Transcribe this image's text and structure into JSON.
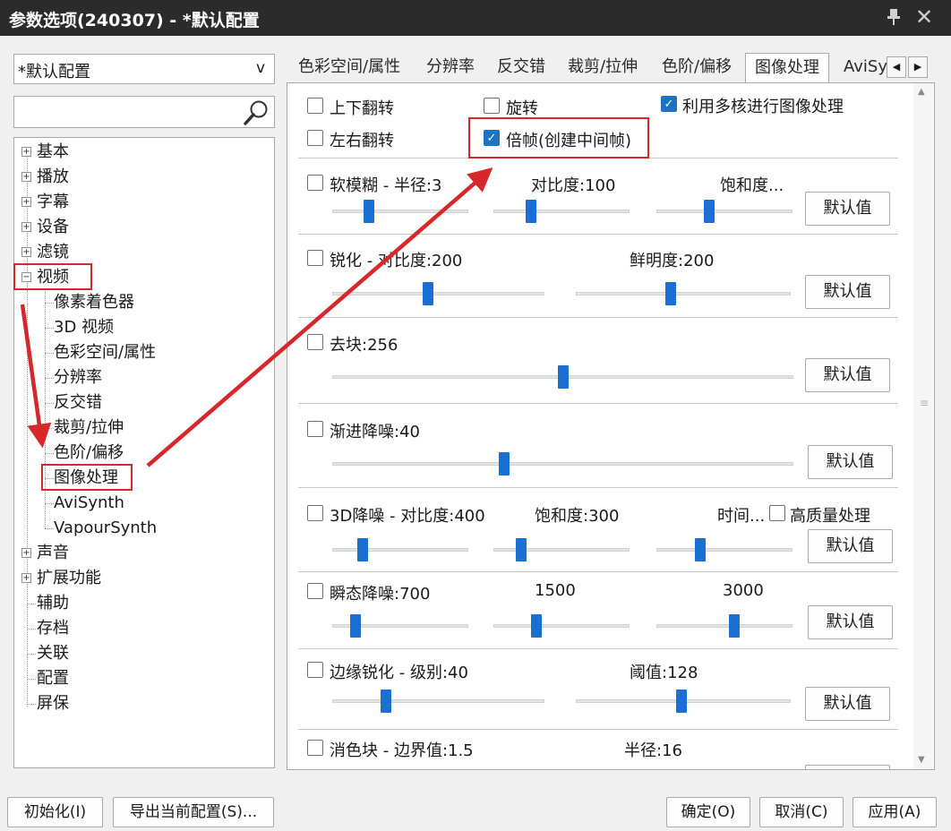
{
  "window": {
    "title": "参数选项(240307) - *默认配置",
    "pin_icon": "pin-icon",
    "close_icon": "close-icon",
    "close_glyph": "✕"
  },
  "profile_select": {
    "value": "*默认配置",
    "arrow": "v"
  },
  "search": {
    "value": "",
    "placeholder": "",
    "icon": "search-icon"
  },
  "tree": {
    "items": [
      {
        "label": "基本",
        "exp": "+"
      },
      {
        "label": "播放",
        "exp": "+"
      },
      {
        "label": "字幕",
        "exp": "+"
      },
      {
        "label": "设备",
        "exp": "+"
      },
      {
        "label": "滤镜",
        "exp": "+"
      },
      {
        "label": "视频",
        "exp": "−"
      },
      {
        "label": "像素着色器"
      },
      {
        "label": "3D 视频"
      },
      {
        "label": "色彩空间/属性"
      },
      {
        "label": "分辨率"
      },
      {
        "label": "反交错"
      },
      {
        "label": "裁剪/拉伸"
      },
      {
        "label": "色阶/偏移"
      },
      {
        "label": "图像处理"
      },
      {
        "label": "AviSynth"
      },
      {
        "label": "VapourSynth"
      },
      {
        "label": "声音",
        "exp": "+"
      },
      {
        "label": "扩展功能",
        "exp": "+"
      },
      {
        "label": "辅助"
      },
      {
        "label": "存档"
      },
      {
        "label": "关联"
      },
      {
        "label": "配置"
      },
      {
        "label": "屏保"
      }
    ]
  },
  "tabs": [
    "色彩空间/属性",
    "分辨率",
    "反交错",
    "裁剪/拉伸",
    "色阶/偏移",
    "图像处理",
    "AviSy"
  ],
  "tab_scroll": {
    "left": "◀",
    "right": "▶"
  },
  "scrollbar": {
    "up": "▲",
    "down": "▼",
    "grip": "≡"
  },
  "options": {
    "flip_v": "上下翻转",
    "rotate": "旋转",
    "multicore": "利用多核进行图像处理",
    "flip_h": "左右翻转",
    "double_frame": "倍帧(创建中间帧)"
  },
  "check_glyph": "✓",
  "sections": {
    "soft_blur": {
      "label": "软模糊 - 半径:3",
      "contrast": "对比度:100",
      "saturation": "饱和度...",
      "button": "默认值",
      "levels": [
        0.25,
        0.26,
        0.38
      ]
    },
    "sharpen": {
      "label": "锐化 - 对比度:200",
      "vividness": "鲜明度:200",
      "button": "默认值",
      "levels": [
        0.45,
        0.44
      ]
    },
    "deblock": {
      "label": "去块:256",
      "button": "默认值",
      "level": 0.5
    },
    "denoise_progressive": {
      "label": "渐进降噪:40",
      "button": "默认值",
      "level": 0.37
    },
    "denoise_3d": {
      "label": "3D降噪 - 对比度:400",
      "saturation": "饱和度:300",
      "time": "时间...",
      "hq": "高质量处理",
      "button": "默认值",
      "levels": [
        0.2,
        0.18,
        0.31
      ]
    },
    "transient": {
      "label": "瞬态降噪:700",
      "val2": "1500",
      "val3": "3000",
      "button": "默认值",
      "levels": [
        0.14,
        0.3,
        0.58
      ]
    },
    "edge_sharpen": {
      "label": "边缘锐化 - 级别:40",
      "threshold": "阈值:128",
      "button": "默认值",
      "levels": [
        0.24,
        0.49
      ]
    },
    "decolor": {
      "label": "消色块 - 边界值:1.5",
      "radius": "半径:16"
    }
  },
  "bottom": {
    "reset": "初始化(I)",
    "export": "导出当前配置(S)...",
    "ok": "确定(O)",
    "cancel": "取消(C)",
    "apply": "应用(A)"
  },
  "annotation_color": "#d6272b",
  "accent_color": "#1a6fd2"
}
